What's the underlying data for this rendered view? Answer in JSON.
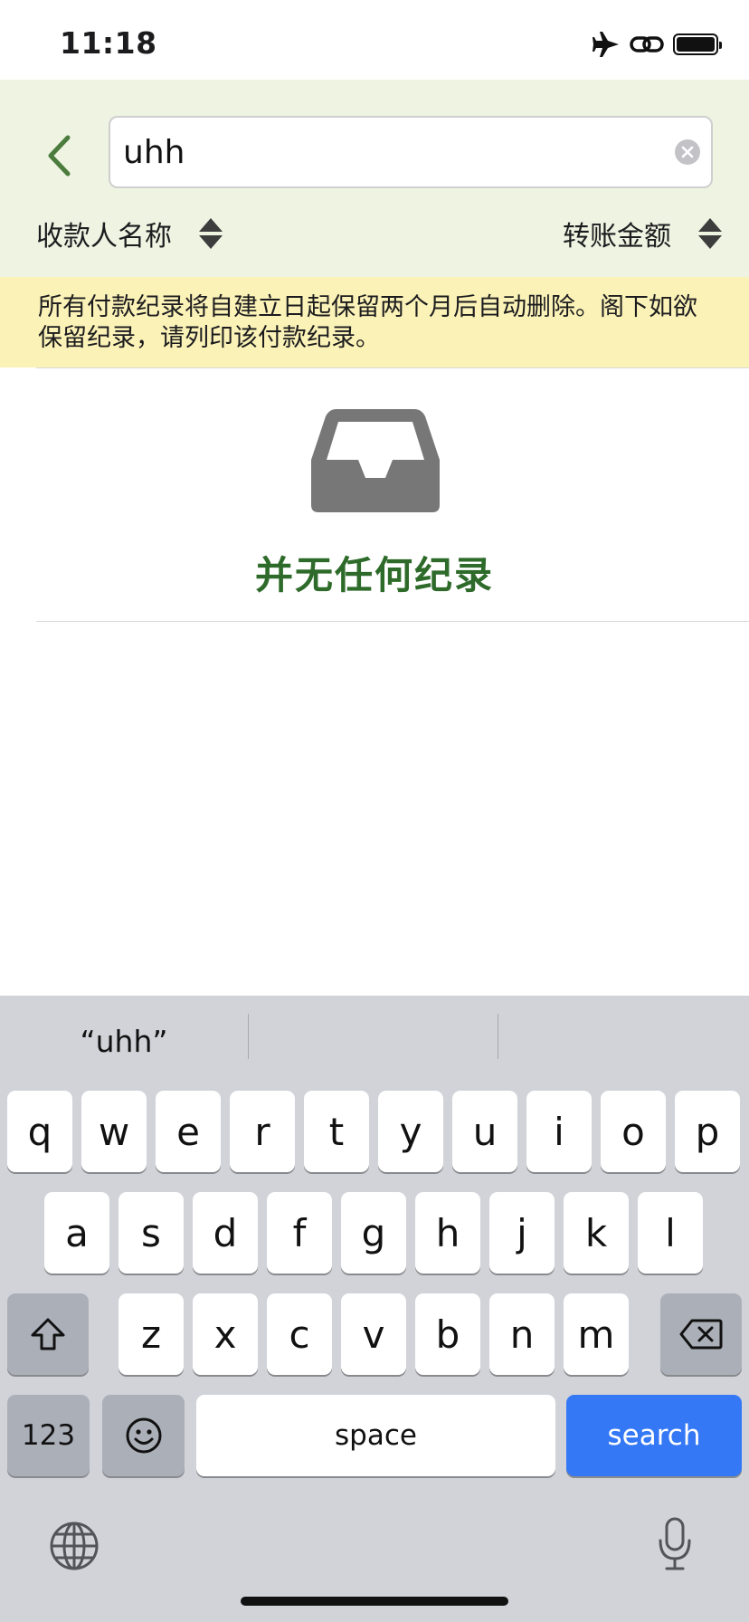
{
  "status_bar": {
    "time": "11:18",
    "icons": [
      "airplane-icon",
      "link-icon",
      "battery-icon"
    ]
  },
  "header": {
    "search_value": "uhh",
    "sort_left_label": "收款人名称",
    "sort_right_label": "转账金额"
  },
  "notice": {
    "text": "所有付款纪录将自建立日起保留两个月后自动删除。阁下如欲保留纪录，请列印该付款纪录。"
  },
  "empty_state": {
    "icon": "inbox-tray-icon",
    "text": "并无任何纪录"
  },
  "keyboard": {
    "suggestions": [
      "“uhh”",
      "",
      ""
    ],
    "row1": [
      "q",
      "w",
      "e",
      "r",
      "t",
      "y",
      "u",
      "i",
      "o",
      "p"
    ],
    "row2": [
      "a",
      "s",
      "d",
      "f",
      "g",
      "h",
      "j",
      "k",
      "l"
    ],
    "row3": [
      "z",
      "x",
      "c",
      "v",
      "b",
      "n",
      "m"
    ],
    "numbers_label": "123",
    "space_label": "space",
    "search_label": "search"
  },
  "colors": {
    "header_bg": "#eff3e2",
    "notice_bg": "#fbf2b8",
    "accent_green": "#2e6b2a",
    "keyboard_bg": "#d1d3d9",
    "search_key_blue": "#3478f6"
  }
}
